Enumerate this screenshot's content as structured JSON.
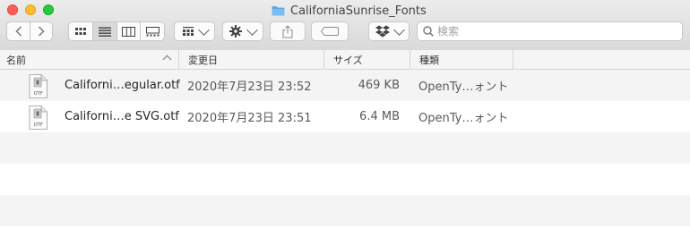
{
  "window": {
    "title": "CaliforniaSunrise_Fonts"
  },
  "search": {
    "placeholder": "検索"
  },
  "columns": {
    "name": "名前",
    "modified": "変更日",
    "size": "サイズ",
    "kind": "種類"
  },
  "files": [
    {
      "name": "Californi…egular.otf",
      "modified": "2020年7月23日 23:52",
      "size": "469 KB",
      "kind": "OpenTy…ォント",
      "icon_label": "OTF"
    },
    {
      "name": "Californi…e SVG.otf",
      "modified": "2020年7月23日 23:51",
      "size": "6.4 MB",
      "kind": "OpenTy…ォント",
      "icon_label": "OTF"
    }
  ],
  "colors": {
    "close": "#fe5f57",
    "minimize": "#febc2e",
    "zoom": "#28c840",
    "folder": "#5aa9e6",
    "stripe": "#f4f4f4"
  }
}
